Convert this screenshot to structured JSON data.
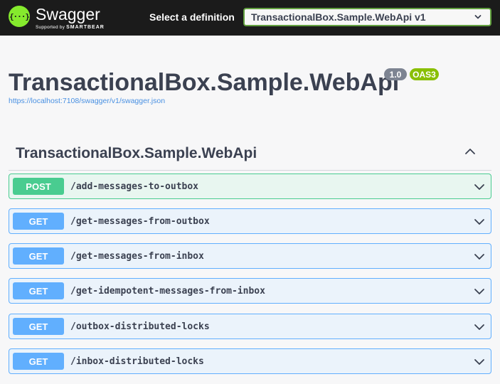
{
  "topbar": {
    "logo_icon": "curly-braces-icon",
    "logo_glyph": "{···}",
    "logo_word": "Swagger",
    "logo_sub_prefix": "Supported by ",
    "logo_sub_brand": "SMARTBEAR",
    "select_label": "Select a definition",
    "select_value": "TransactionalBox.Sample.WebApi v1"
  },
  "info": {
    "title": "TransactionalBox.Sample.WebApi",
    "version": "1.0",
    "oas": "OAS3",
    "spec_url": "https://localhost:7108/swagger/v1/swagger.json"
  },
  "section": {
    "title": "TransactionalBox.Sample.WebApi",
    "toggle_icon": "chevron-up-icon"
  },
  "operations": [
    {
      "method": "POST",
      "path": "/add-messages-to-outbox"
    },
    {
      "method": "GET",
      "path": "/get-messages-from-outbox"
    },
    {
      "method": "GET",
      "path": "/get-messages-from-inbox"
    },
    {
      "method": "GET",
      "path": "/get-idempotent-messages-from-inbox"
    },
    {
      "method": "GET",
      "path": "/outbox-distributed-locks"
    },
    {
      "method": "GET",
      "path": "/inbox-distributed-locks"
    }
  ],
  "colors": {
    "topbar_bg": "#1b1b1b",
    "logo_green": "#85ea2d",
    "post": "#49cc90",
    "get": "#61affe",
    "text": "#3b4151"
  }
}
